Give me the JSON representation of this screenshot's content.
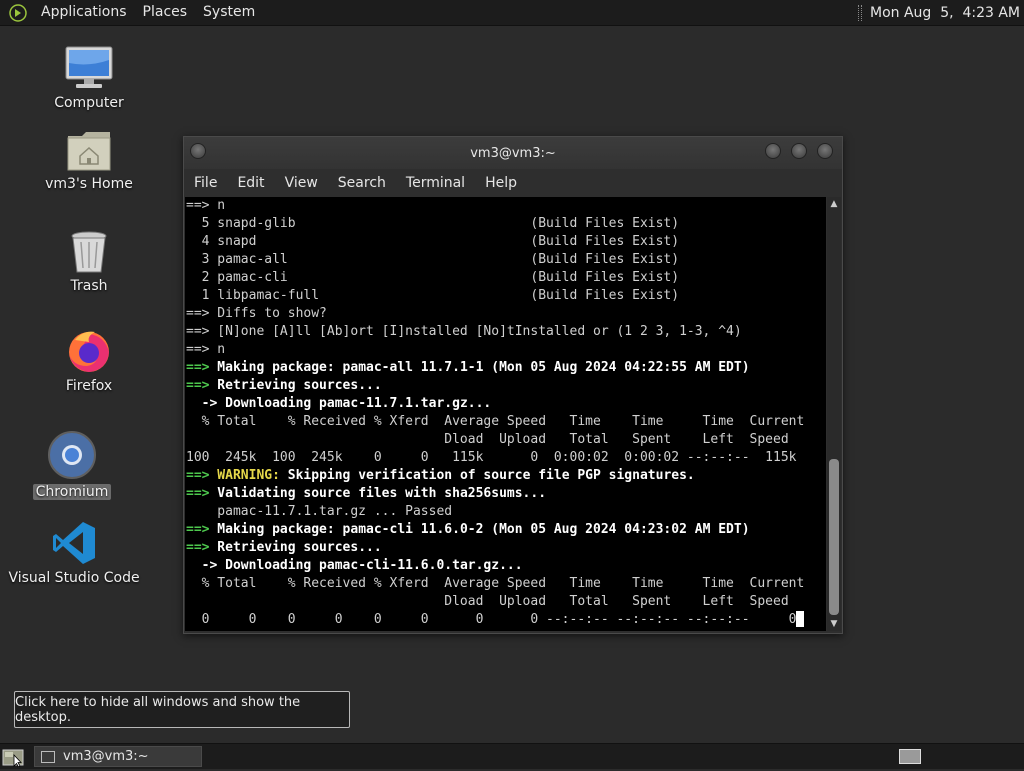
{
  "top_panel": {
    "menus": [
      "Applications",
      "Places",
      "System"
    ],
    "clock": "Mon Aug  5,  4:23 AM"
  },
  "desktop_icons": [
    {
      "label": "Computer",
      "icon": "computer-icon"
    },
    {
      "label": "vm3's Home",
      "icon": "home-folder-icon"
    },
    {
      "label": "Trash",
      "icon": "trash-icon"
    },
    {
      "label": "Firefox",
      "icon": "firefox-icon"
    },
    {
      "label": "Chromium",
      "icon": "chromium-icon",
      "selected": true
    },
    {
      "label": "Visual Studio Code",
      "icon": "vscode-icon"
    }
  ],
  "window": {
    "title": "vm3@vm3:~",
    "menu": [
      "File",
      "Edit",
      "View",
      "Search",
      "Terminal",
      "Help"
    ]
  },
  "terminal_lines": [
    [
      {
        "t": "==> n"
      }
    ],
    [
      {
        "t": "  5 snapd-glib                              (Build Files Exist)"
      }
    ],
    [
      {
        "t": "  4 snapd                                   (Build Files Exist)"
      }
    ],
    [
      {
        "t": "  3 pamac-all                               (Build Files Exist)"
      }
    ],
    [
      {
        "t": "  2 pamac-cli                               (Build Files Exist)"
      }
    ],
    [
      {
        "t": "  1 libpamac-full                           (Build Files Exist)"
      }
    ],
    [
      {
        "t": "==> Diffs to show?"
      }
    ],
    [
      {
        "t": "==> [N]one [A]ll [Ab]ort [I]nstalled [No]tInstalled or (1 2 3, 1-3, ^4)"
      }
    ],
    [
      {
        "t": "==> n"
      }
    ],
    [
      {
        "t": "==>",
        "c": "g"
      },
      {
        "t": " Making package: pamac-all 11.7.1-1 (Mon 05 Aug 2024 04:22:55 AM EDT)",
        "c": "b"
      }
    ],
    [
      {
        "t": "==>",
        "c": "g"
      },
      {
        "t": " Retrieving sources...",
        "c": "b"
      }
    ],
    [
      {
        "t": "  ->",
        "c": "b"
      },
      {
        "t": " Downloading pamac-11.7.1.tar.gz...",
        "c": "b"
      }
    ],
    [
      {
        "t": "  % Total    % Received % Xferd  Average Speed   Time    Time     Time  Current"
      }
    ],
    [
      {
        "t": "                                 Dload  Upload   Total   Spent    Left  Speed"
      }
    ],
    [
      {
        "t": "100  245k  100  245k    0     0   115k      0  0:00:02  0:00:02 --:--:--  115k"
      }
    ],
    [
      {
        "t": "==>",
        "c": "g"
      },
      {
        "t": " WARNING:",
        "c": "y"
      },
      {
        "t": " Skipping verification of source file PGP signatures.",
        "c": "b"
      }
    ],
    [
      {
        "t": "==>",
        "c": "g"
      },
      {
        "t": " Validating source files with sha256sums...",
        "c": "b"
      }
    ],
    [
      {
        "t": "    pamac-11.7.1.tar.gz ... Passed"
      }
    ],
    [
      {
        "t": "==>",
        "c": "g"
      },
      {
        "t": " Making package: pamac-cli 11.6.0-2 (Mon 05 Aug 2024 04:23:02 AM EDT)",
        "c": "b"
      }
    ],
    [
      {
        "t": "==>",
        "c": "g"
      },
      {
        "t": " Retrieving sources...",
        "c": "b"
      }
    ],
    [
      {
        "t": "  ->",
        "c": "b"
      },
      {
        "t": " Downloading pamac-cli-11.6.0.tar.gz...",
        "c": "b"
      }
    ],
    [
      {
        "t": "  % Total    % Received % Xferd  Average Speed   Time    Time     Time  Current"
      }
    ],
    [
      {
        "t": "                                 Dload  Upload   Total   Spent    Left  Speed"
      }
    ],
    [
      {
        "t": "  0     0    0     0    0     0      0      0 --:--:-- --:--:-- --:--:--     0"
      },
      {
        "cursor": true
      }
    ]
  ],
  "tooltip": "Click here to hide all windows and show the desktop.",
  "taskbar": {
    "task_label": "vm3@vm3:~"
  },
  "colors": {
    "prompt_green": "#4ec94e",
    "warning_yellow": "#e6d84a",
    "terminal_bg": "#000000"
  }
}
